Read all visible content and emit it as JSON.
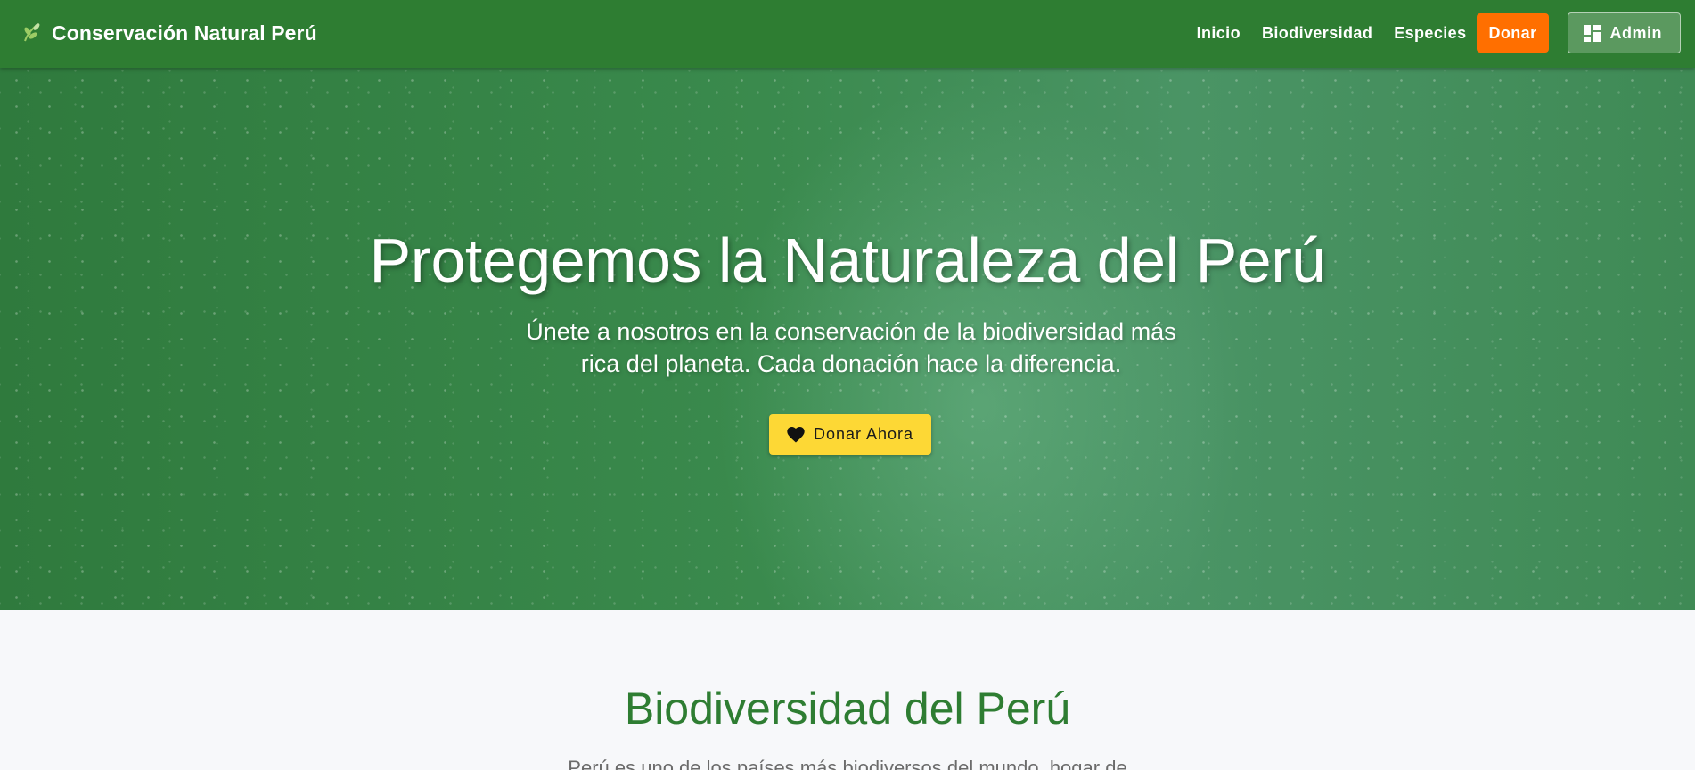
{
  "navbar": {
    "brand": "Conservación Natural Perú",
    "brand_icon": "leaf-icon",
    "links": [
      "Inicio",
      "Biodiversidad",
      "Especies"
    ],
    "donate_label": "Donar",
    "admin_label": "Admin",
    "admin_icon": "dashboard-icon"
  },
  "hero": {
    "title": "Protegemos la Naturaleza del Perú",
    "subtitle": "Únete a nosotros en la conservación de la biodiversidad más rica del planeta. Cada donación hace la diferencia.",
    "cta_label": "Donar Ahora",
    "cta_icon": "heart-icon"
  },
  "section": {
    "title": "Biodiversidad del Perú",
    "text": "Perú es uno de los países más biodiversos del mundo, hogar de"
  },
  "colors": {
    "primary": "#2e7d32",
    "donate": "#ff6f00",
    "cta": "#fdd835",
    "section_title": "#2e7d32"
  }
}
